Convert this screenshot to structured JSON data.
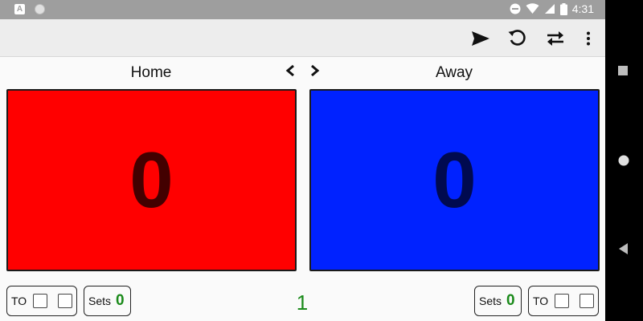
{
  "colors": {
    "home": "#ff0000",
    "away": "#0022ff",
    "score_text_home": "#1a0000",
    "score_text_away": "#00052a",
    "sets_green": "#1a8a1a"
  },
  "status_bar": {
    "time": "4:31",
    "icons": [
      "app-badge-icon",
      "circle-icon",
      "do-not-disturb-icon",
      "wifi-icon",
      "signal-icon",
      "battery-icon"
    ]
  },
  "toolbar": {
    "icons": [
      "send-icon",
      "reset-icon",
      "swap-icon",
      "more-vert-icon"
    ]
  },
  "home": {
    "name": "Home",
    "score": "0",
    "to_label": "TO",
    "sets_label": "Sets",
    "sets_value": "0"
  },
  "away": {
    "name": "Away",
    "score": "0",
    "to_label": "TO",
    "sets_label": "Sets",
    "sets_value": "0"
  },
  "current_set": "1",
  "nav_icons": [
    "overview-icon",
    "home-icon",
    "back-icon"
  ]
}
